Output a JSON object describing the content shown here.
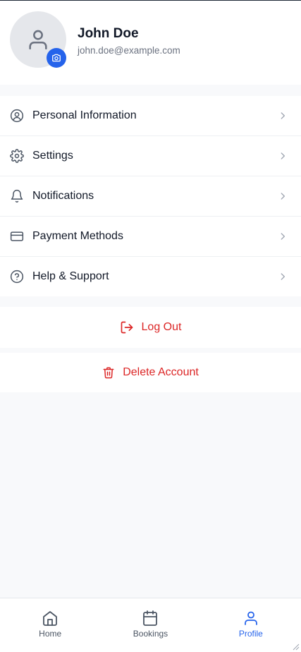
{
  "profile": {
    "name": "John Doe",
    "email": "john.doe@example.com"
  },
  "menu": {
    "items": [
      {
        "label": "Personal Information",
        "icon": "user-circle-icon"
      },
      {
        "label": "Settings",
        "icon": "gear-icon"
      },
      {
        "label": "Notifications",
        "icon": "bell-icon"
      },
      {
        "label": "Payment Methods",
        "icon": "credit-card-icon"
      },
      {
        "label": "Help & Support",
        "icon": "help-circle-icon"
      }
    ]
  },
  "actions": {
    "logout_label": "Log Out",
    "delete_label": "Delete Account"
  },
  "tabbar": {
    "tabs": [
      {
        "label": "Home",
        "icon": "home-icon",
        "active": false
      },
      {
        "label": "Bookings",
        "icon": "calendar-icon",
        "active": false
      },
      {
        "label": "Profile",
        "icon": "user-icon",
        "active": true
      }
    ]
  },
  "colors": {
    "accent": "#2563eb",
    "danger": "#dc2626",
    "background": "#f8f9fb"
  }
}
